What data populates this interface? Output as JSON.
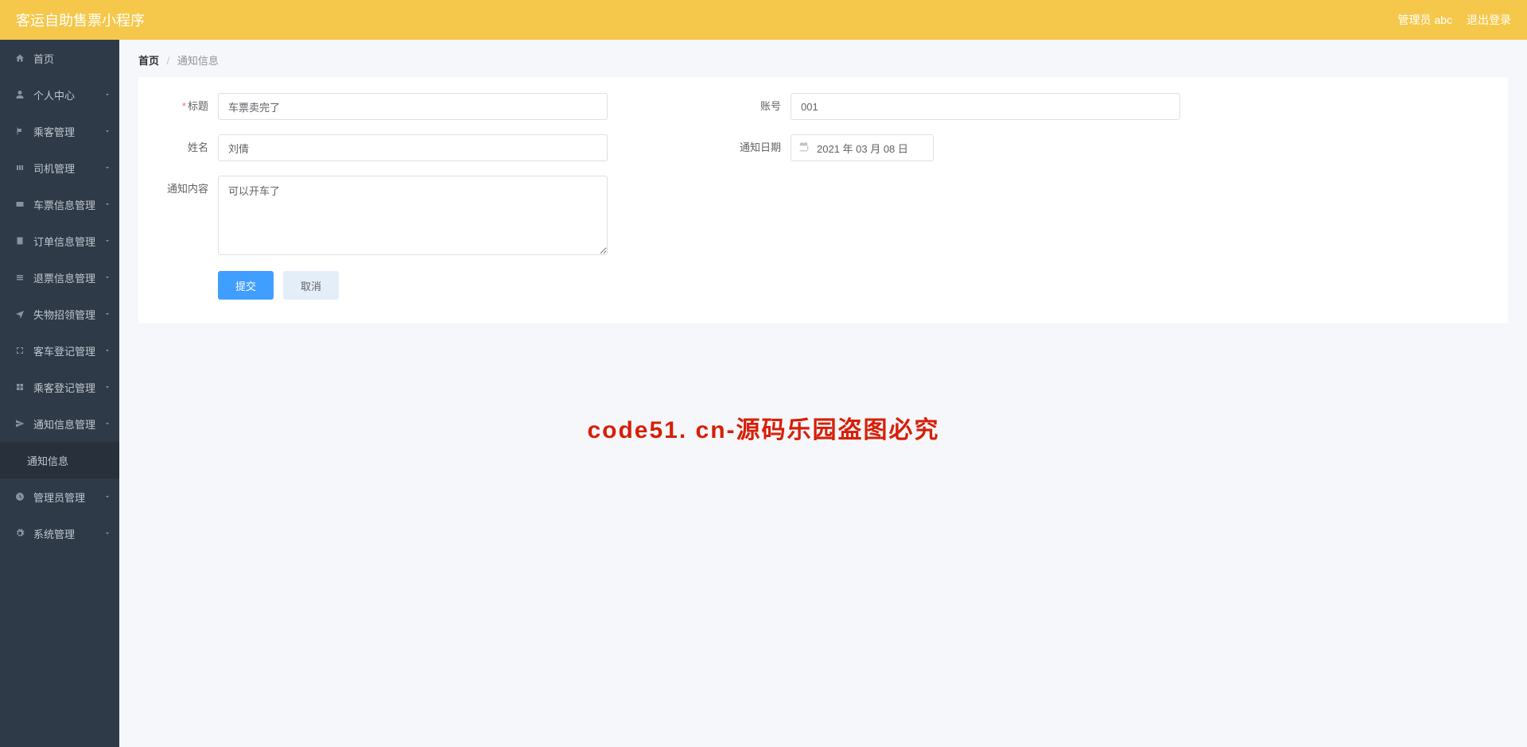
{
  "topbar": {
    "title": "客运自助售票小程序",
    "admin": "管理员 abc",
    "logout": "退出登录"
  },
  "sidebar": {
    "items": [
      {
        "icon": "home",
        "label": "首页",
        "expandable": false
      },
      {
        "icon": "user",
        "label": "个人中心",
        "expandable": true
      },
      {
        "icon": "flag",
        "label": "乘客管理",
        "expandable": true
      },
      {
        "icon": "bars",
        "label": "司机管理",
        "expandable": true
      },
      {
        "icon": "card",
        "label": "车票信息管理",
        "expandable": true
      },
      {
        "icon": "order",
        "label": "订单信息管理",
        "expandable": true
      },
      {
        "icon": "refund",
        "label": "退票信息管理",
        "expandable": true
      },
      {
        "icon": "plane",
        "label": "失物招领管理",
        "expandable": true
      },
      {
        "icon": "expand",
        "label": "客车登记管理",
        "expandable": true
      },
      {
        "icon": "grid",
        "label": "乘客登记管理",
        "expandable": true
      },
      {
        "icon": "send",
        "label": "通知信息管理",
        "expandable": true
      },
      {
        "icon": "time",
        "label": "管理员管理",
        "expandable": true
      },
      {
        "icon": "gear",
        "label": "系统管理",
        "expandable": true
      }
    ],
    "subitem": "通知信息"
  },
  "breadcrumb": {
    "home": "首页",
    "current": "通知信息"
  },
  "form": {
    "title_label": "标题",
    "title_value": "车票卖完了",
    "account_label": "账号",
    "account_value": "001",
    "name_label": "姓名",
    "name_value": "刘倩",
    "date_label": "通知日期",
    "date_value": "2021 年 03 月 08 日",
    "content_label": "通知内容",
    "content_value": "可以开车了",
    "submit": "提交",
    "cancel": "取消"
  },
  "watermark": "code51. cn-源码乐园盗图必究"
}
